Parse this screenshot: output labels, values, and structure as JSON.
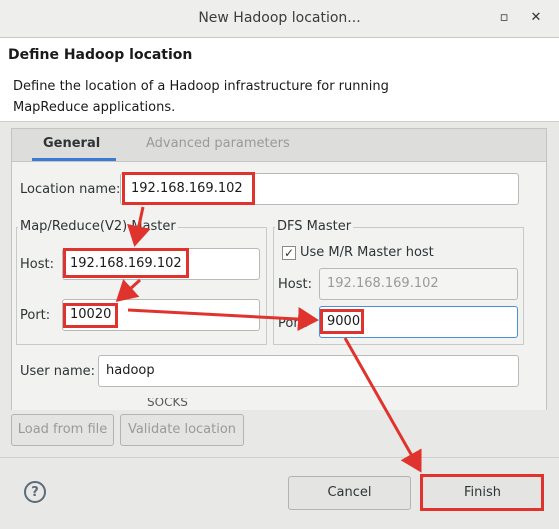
{
  "window": {
    "title": "New Hadoop location...",
    "restore_glyph": "▫",
    "close_glyph": "✕"
  },
  "header": {
    "title": "Define Hadoop location",
    "description_line1": "Define the location of a Hadoop infrastructure for running",
    "description_line2": "MapReduce applications."
  },
  "tabs": [
    {
      "label": "General",
      "active": true
    },
    {
      "label": "Advanced parameters",
      "active": false
    }
  ],
  "general": {
    "location_name_label": "Location name:",
    "location_name_value": "192.168.169.102",
    "mr_master": {
      "group_title": "Map/Reduce(V2) Master",
      "host_label": "Host:",
      "host_value": "192.168.169.102",
      "port_label": "Port:",
      "port_value": "10020"
    },
    "dfs_master": {
      "group_title": "DFS Master",
      "use_mr_host_label": "Use M/R Master host",
      "use_mr_host_checked": true,
      "host_label": "Host:",
      "host_value": "192.168.169.102",
      "port_label": "Port:",
      "port_value": "9000"
    },
    "user_name_label": "User name:",
    "user_name_value": "hadoop",
    "socks_partial": "SOCKS"
  },
  "buttons": {
    "load_from_file": "Load from file",
    "validate_location": "Validate location",
    "help": "?",
    "cancel": "Cancel",
    "finish": "Finish"
  },
  "annotations": {
    "highlight_color": "#e0332e"
  }
}
